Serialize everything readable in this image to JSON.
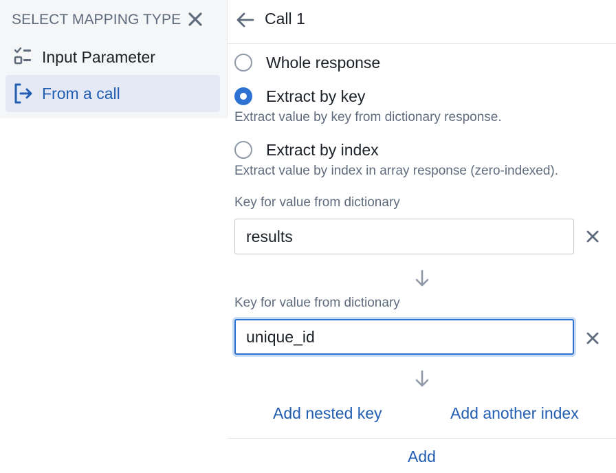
{
  "left_panel": {
    "title": "SELECT MAPPING TYPE",
    "close_icon": "close-icon",
    "items": [
      {
        "label": "Input Parameter",
        "icon": "form-checklist-icon",
        "selected": false
      },
      {
        "label": "From a call",
        "icon": "log-in-icon",
        "selected": true
      }
    ]
  },
  "right_panel": {
    "back_icon": "arrow-left-icon",
    "title": "Call 1",
    "radio_options": [
      {
        "label": "Whole response",
        "description": "",
        "checked": false
      },
      {
        "label": "Extract by key",
        "description": "Extract value by key from dictionary response.",
        "checked": true
      },
      {
        "label": "Extract by index",
        "description": "Extract value by index in array response (zero-indexed).",
        "checked": false
      }
    ],
    "key_fields": [
      {
        "label": "Key for value from dictionary",
        "value": "results",
        "focused": false
      },
      {
        "label": "Key for value from dictionary",
        "value": "unique_id",
        "focused": true
      }
    ],
    "actions": {
      "add_nested_key": "Add nested key",
      "add_another_index": "Add another index"
    },
    "footer": {
      "add_label": "Add"
    }
  },
  "colors": {
    "accent": "#2d72d2",
    "link": "#215db0",
    "selected_bg": "#e4e9f5",
    "muted_text": "#5f6b7c",
    "panel_bg": "#f5f6f8"
  }
}
